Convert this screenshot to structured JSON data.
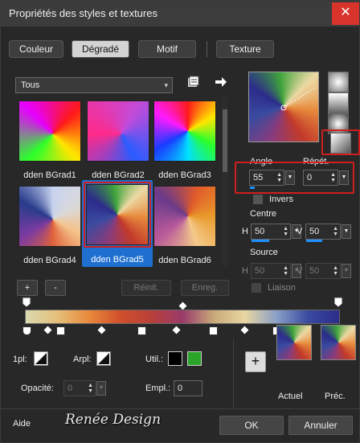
{
  "window": {
    "title": "Propriétés des styles et textures",
    "close_icon": "✕"
  },
  "tabs": [
    {
      "label": "Couleur"
    },
    {
      "label": "Dégradé",
      "active": true
    },
    {
      "label": "Motif"
    },
    {
      "label": "Texture"
    }
  ],
  "category": {
    "value": "Tous",
    "arrow": "▾"
  },
  "gradients": [
    {
      "name": "dden BGrad1"
    },
    {
      "name": "dden BGrad2"
    },
    {
      "name": "dden BGrad3"
    },
    {
      "name": "dden BGrad4"
    },
    {
      "name": "dden BGrad5",
      "selected": true
    },
    {
      "name": "dden BGrad6"
    }
  ],
  "buttons": {
    "add": "+",
    "remove": "-",
    "reset": "Réinit.",
    "save": "Enreg.",
    "ok": "OK",
    "cancel": "Annuler",
    "help": "Aide",
    "add_plus": "+"
  },
  "angle": {
    "label": "Angle",
    "value": "55",
    "fill": 0.15
  },
  "repeat": {
    "label": "Répét.",
    "value": "0",
    "fill": 0
  },
  "invert": {
    "label": "Invers"
  },
  "center": {
    "label": "Centre",
    "h_label": "H",
    "h": "50",
    "v_label": "V",
    "v": "50"
  },
  "source": {
    "label": "Source",
    "h_label": "H",
    "h": "50",
    "v_label": "V",
    "v": "50"
  },
  "link": {
    "label": "Liaison"
  },
  "bottom": {
    "opl_label": "1pl:",
    "arpl_label": "Arpl:",
    "util_label": "Util.:",
    "opacity_label": "Opacité:",
    "opacity_value": "0",
    "empl_label": "Empl.:",
    "empl_value": "0"
  },
  "previews": {
    "current": "Actuel",
    "previous": "Préc."
  },
  "watermark": "Renée Design",
  "colors": {
    "accent": "#1e90ff",
    "highlight": "#d01f1f",
    "swatch_black": "#000000",
    "swatch_green": "#2aa52a"
  }
}
